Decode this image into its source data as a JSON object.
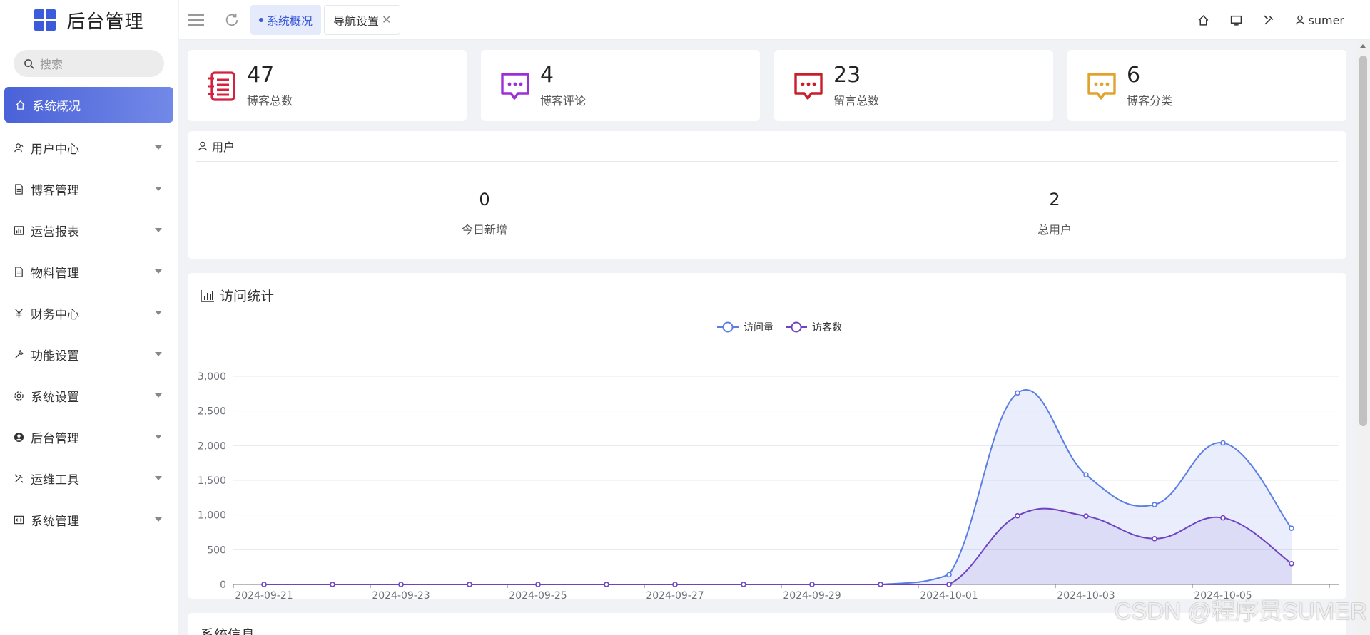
{
  "app": {
    "title": "后台管理"
  },
  "search": {
    "placeholder": "搜索"
  },
  "sidebar": {
    "items": [
      {
        "label": "系统概况",
        "icon": "home-icon",
        "active": true
      },
      {
        "label": "用户中心",
        "icon": "users-icon"
      },
      {
        "label": "博客管理",
        "icon": "document-icon"
      },
      {
        "label": "运营报表",
        "icon": "bar-chart-icon"
      },
      {
        "label": "物料管理",
        "icon": "document-icon"
      },
      {
        "label": "财务中心",
        "icon": "yen-icon"
      },
      {
        "label": "功能设置",
        "icon": "wrench-icon"
      },
      {
        "label": "系统设置",
        "icon": "gear-icon"
      },
      {
        "label": "后台管理",
        "icon": "user-circle-icon"
      },
      {
        "label": "运维工具",
        "icon": "tools-icon"
      },
      {
        "label": "系统管理",
        "icon": "code-icon"
      }
    ]
  },
  "topbar": {
    "tabs": [
      {
        "label": "系统概况",
        "active": true
      },
      {
        "label": "导航设置",
        "close": "✕"
      }
    ],
    "username": "sumer"
  },
  "stats": [
    {
      "value": "47",
      "label": "博客总数",
      "color": "#d4213d",
      "icon": "notebook-icon"
    },
    {
      "value": "4",
      "label": "博客评论",
      "color": "#9b30d9",
      "icon": "comment-icon"
    },
    {
      "value": "23",
      "label": "留言总数",
      "color": "#c81e2a",
      "icon": "comment-icon"
    },
    {
      "value": "6",
      "label": "博客分类",
      "color": "#e0a32e",
      "icon": "comment-icon"
    }
  ],
  "users": {
    "title": "用户",
    "today_new": {
      "value": "0",
      "label": "今日新增"
    },
    "total": {
      "value": "2",
      "label": "总用户"
    }
  },
  "visit": {
    "title": "访问统计"
  },
  "chart_data": {
    "type": "area",
    "title": "访问统计",
    "x": [
      "2024-09-21",
      "2024-09-22",
      "2024-09-23",
      "2024-09-24",
      "2024-09-25",
      "2024-09-26",
      "2024-09-27",
      "2024-09-28",
      "2024-09-29",
      "2024-09-30",
      "2024-10-01",
      "2024-10-02",
      "2024-10-03",
      "2024-10-04",
      "2024-10-05",
      "2024-10-06"
    ],
    "x_tick_labels": [
      "2024-09-21",
      "2024-09-23",
      "2024-09-25",
      "2024-09-27",
      "2024-09-29",
      "2024-10-01",
      "2024-10-03",
      "2024-10-05"
    ],
    "y_ticks": [
      "0",
      "500",
      "1,000",
      "1,500",
      "2,000",
      "2,500",
      "3,000"
    ],
    "ylim": [
      0,
      3000
    ],
    "series": [
      {
        "name": "访问量",
        "color": "#5b7ee5",
        "values": [
          0,
          0,
          0,
          0,
          0,
          0,
          0,
          0,
          0,
          0,
          140,
          2760,
          1580,
          1150,
          2040,
          810
        ]
      },
      {
        "name": "访客数",
        "color": "#6f42c1",
        "values": [
          0,
          0,
          0,
          0,
          0,
          0,
          0,
          0,
          0,
          0,
          0,
          990,
          985,
          660,
          960,
          300
        ]
      }
    ],
    "legend": "top-center",
    "grid": true,
    "smooth": true
  },
  "sysinfo": {
    "title": "系统信息"
  },
  "watermark": "CSDN @程序员SUMER"
}
